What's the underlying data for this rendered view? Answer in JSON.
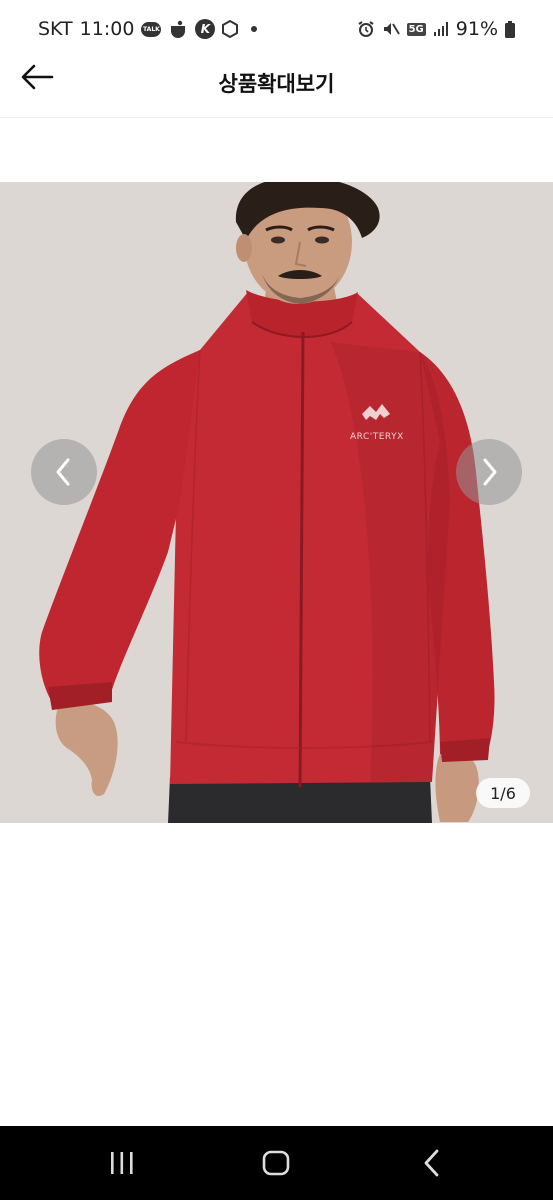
{
  "status_bar": {
    "carrier": "SKT",
    "time": "11:00",
    "talk_label": "TALK",
    "k_label": "K",
    "network": "5G",
    "battery": "91%"
  },
  "header": {
    "title": "상품확대보기"
  },
  "viewer": {
    "brand_logo_text": "ARC'TERYX",
    "current_index": 1,
    "total_images": 6,
    "counter": "1/6"
  },
  "colors": {
    "jacket": "#c42a33",
    "background": "#dcd7d3",
    "nav_bar": "#000000"
  }
}
